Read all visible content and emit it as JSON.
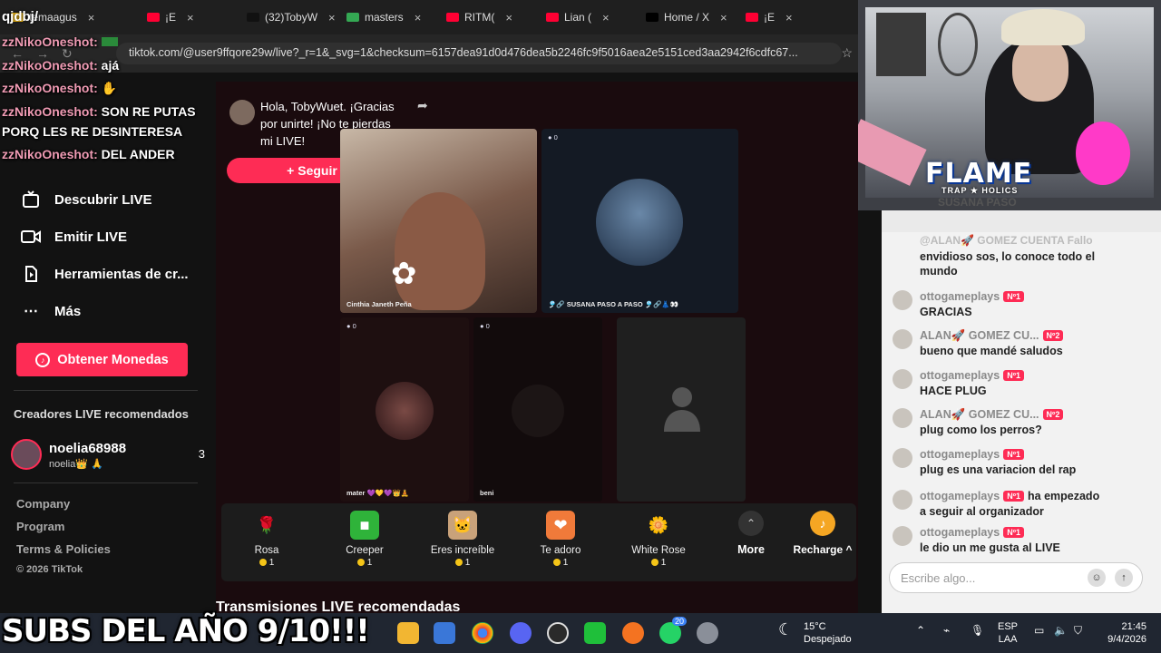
{
  "browser": {
    "tabs": [
      {
        "label": "temaagus",
        "color": "#ffc20e"
      },
      {
        "label": "¡E",
        "color": "#ff0033"
      },
      {
        "label": "(32)TobyW",
        "color": "#111111"
      },
      {
        "label": "masters",
        "color": "#34a853"
      },
      {
        "label": "RITM(",
        "color": "#ff0033"
      },
      {
        "label": "Lian (",
        "color": "#ff0033"
      },
      {
        "label": "Home / X",
        "color": "#000000"
      },
      {
        "label": "¡E",
        "color": "#ff0033"
      }
    ],
    "url": "tiktok.com/@user9ffqore29w/live?_r=1&_svg=1&checksum=6157dea91d0d476dea5b2246fc9f5016aea2e5151ced3aa2942f6cdfc67..."
  },
  "overlay_chat": [
    {
      "user": "zzNikoOneshot:",
      "text": ""
    },
    {
      "user": "zzNikoOneshot:",
      "text": "ajá"
    },
    {
      "user": "zzNikoOneshot:",
      "text": ""
    },
    {
      "user": "zzNikoOneshot:",
      "text": "SON RE PUTAS"
    },
    {
      "user": "",
      "text": "PORQ LES RE DESINTERESA"
    },
    {
      "user": "zzNikoOneshot:",
      "text": "DEL ANDER"
    }
  ],
  "overlay_top": "qjdbj/",
  "sidebar": {
    "nav": [
      {
        "label": "Descubrir LIVE",
        "icon": "live-tv-icon"
      },
      {
        "label": "Emitir LIVE",
        "icon": "camera-icon"
      },
      {
        "label": "Herramientas de cr...",
        "icon": "tools-icon"
      },
      {
        "label": "Más",
        "icon": "more-dots-icon"
      }
    ],
    "coins_button": "Obtener Monedas",
    "recommended_heading": "Creadores LIVE recomendados",
    "recommended": {
      "name": "noelia68988",
      "sub": "noelia👑 🙏",
      "count": "3"
    },
    "footer": [
      "Company",
      "Program",
      "Terms & Policies",
      "© 2026 TikTok"
    ]
  },
  "live": {
    "greeting": "Hola, TobyWuet. ¡Gracias por unirte! ¡No te pierdas mi LIVE!",
    "follow_button": "+ Seguir",
    "tiles": [
      {
        "label": "Cinthia Janeth Peña",
        "count": ""
      },
      {
        "label": "🎐🔗 SUSANA PASO A PASO 🎐🔗👗👀",
        "count": "0"
      },
      {
        "label": "mater 💜💛💜👑🧘",
        "count": "0"
      },
      {
        "label": "beni",
        "count": "0"
      },
      {
        "label": "",
        "count": ""
      }
    ],
    "gifts": [
      {
        "name": "Rosa",
        "price": "1",
        "icon": "rose-icon",
        "emoji": "🌹"
      },
      {
        "name": "Creeper",
        "price": "1",
        "icon": "creeper-icon",
        "emoji": "■"
      },
      {
        "name": "Eres increíble",
        "price": "1",
        "icon": "cat-icon",
        "emoji": "🐱"
      },
      {
        "name": "Te adoro",
        "price": "1",
        "icon": "heart-icon",
        "emoji": "❤"
      },
      {
        "name": "White Rose",
        "price": "1",
        "icon": "white-rose-icon",
        "emoji": "🌼"
      }
    ],
    "more_label": "More",
    "recharge_label": "Recharge ^",
    "recommended_streams": "Transmisiones LIVE recomendadas"
  },
  "chat": {
    "top_partial": "@ALAN🚀 GOMEZ CUENTA Fallo",
    "items": [
      {
        "user": "",
        "badge": "",
        "action": "",
        "text": "envidioso sos, lo conoce todo el"
      },
      {
        "user": "",
        "badge": "",
        "action": "",
        "text": "mundo"
      },
      {
        "user": "ottogameplays",
        "badge": "Nº1",
        "action": "",
        "text": "GRACIAS"
      },
      {
        "user": "ALAN🚀 GOMEZ CU...",
        "badge": "Nº2",
        "action": "",
        "text": "bueno que mandé saludos"
      },
      {
        "user": "ottogameplays",
        "badge": "Nº1",
        "action": "",
        "text": "HACE PLUG"
      },
      {
        "user": "ALAN🚀 GOMEZ CU...",
        "badge": "Nº2",
        "action": "",
        "text": "plug como los perros?"
      },
      {
        "user": "ottogameplays",
        "badge": "Nº1",
        "action": "",
        "text": "plug es una variacion del rap"
      },
      {
        "user": "ottogameplays",
        "badge": "Nº1",
        "action": "ha empezado",
        "text": "a seguir al organizador"
      },
      {
        "user": "ottogameplays",
        "badge": "Nº1",
        "action": "",
        "text": "le dio un me gusta al LIVE"
      }
    ],
    "input_placeholder": "Escribe algo..."
  },
  "webcam": {
    "title": "FLAME",
    "subtitle": "TRAP ★ HOLICS",
    "partial": "SUSANA PASO"
  },
  "stream_overlay": "SUBS DEL AÑO 9/10!!!",
  "taskbar": {
    "weather_temp": "15°C",
    "weather_desc": "Despejado",
    "lang": "ESP",
    "layout": "LAA",
    "time": "21:45",
    "date": "9/4/2026",
    "badge": "20"
  }
}
